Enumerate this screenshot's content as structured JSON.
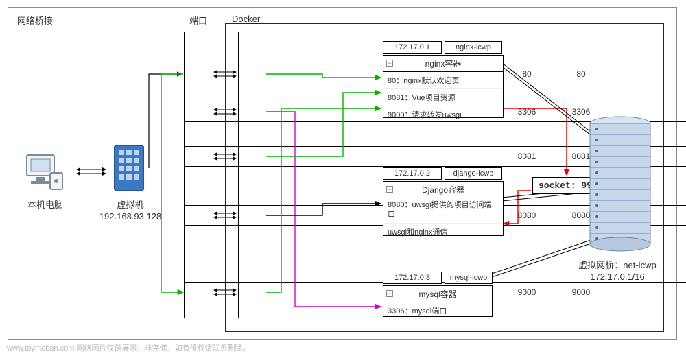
{
  "labels": {
    "bridge": "网络桥接",
    "ports": "端口",
    "docker": "Docker",
    "local_pc": "本机电脑",
    "vm": "虚拟机",
    "vm_ip": "192.168.93.128",
    "vbridge": "虚拟网桥：net-icwp",
    "vbridge_cidr": "172.17.0.1/16",
    "watermark": "www.toymoban.com 网络图片仅供展示，非存储，如有侵权请联系删除。"
  },
  "ports": [
    "80",
    "3306",
    "8081",
    "8080",
    "9000"
  ],
  "containers": {
    "nginx": {
      "ip": "172.17.0.1",
      "name": "nginx-icwp",
      "title": "nginx容器",
      "lines": [
        "80：nginx默认欢迎页",
        "8081：Vue项目资源",
        "9000：请求转发uwsgi"
      ]
    },
    "django": {
      "ip": "172.17.0.2",
      "name": "django-icwp",
      "title": "Django容器",
      "lines": [
        "8080：uwsgi提供的项目访问端口",
        "uwsgi和nginx通信"
      ]
    },
    "mysql": {
      "ip": "172.17.0.3",
      "name": "mysql-icwp",
      "title": "mysql容器",
      "lines": [
        "3306：mysql端口"
      ]
    }
  },
  "socket": "socket: 9999"
}
